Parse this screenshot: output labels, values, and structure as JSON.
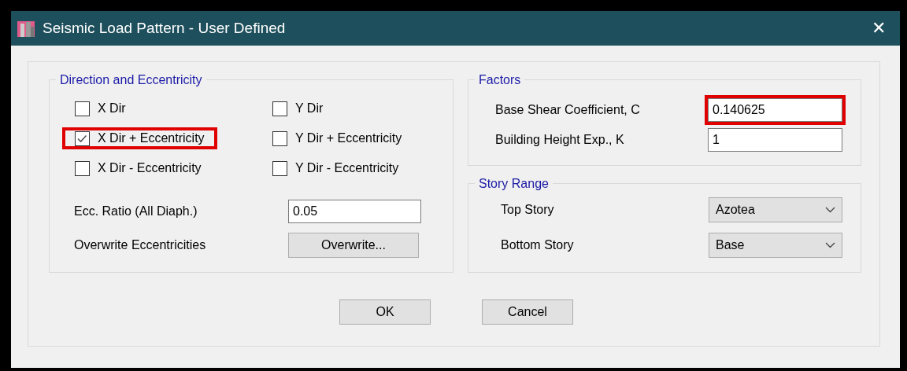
{
  "window": {
    "title": "Seismic Load Pattern - User Defined",
    "close": "✕"
  },
  "direction": {
    "title": "Direction and Eccentricity",
    "checkboxes": [
      {
        "label": "X Dir",
        "checked": false,
        "highlighted": false
      },
      {
        "label": "Y Dir",
        "checked": false,
        "highlighted": false
      },
      {
        "label": "X Dir + Eccentricity",
        "checked": true,
        "highlighted": true
      },
      {
        "label": "Y Dir + Eccentricity",
        "checked": false,
        "highlighted": false
      },
      {
        "label": "X Dir - Eccentricity",
        "checked": false,
        "highlighted": false
      },
      {
        "label": "Y Dir - Eccentricity",
        "checked": false,
        "highlighted": false
      }
    ],
    "ecc_ratio": {
      "label": "Ecc. Ratio (All Diaph.)",
      "value": "0.05"
    },
    "overwrite": {
      "label": "Overwrite Eccentricities",
      "button": "Overwrite..."
    }
  },
  "factors": {
    "title": "Factors",
    "fields": [
      {
        "label": "Base Shear Coefficient, C",
        "value": "0.140625",
        "highlighted": true
      },
      {
        "label": "Building Height Exp., K",
        "value": "1",
        "highlighted": false
      }
    ]
  },
  "story_range": {
    "title": "Story Range",
    "selects": [
      {
        "label": "Top Story",
        "value": "Azotea"
      },
      {
        "label": "Bottom Story",
        "value": "Base"
      }
    ]
  },
  "buttons": [
    "OK",
    "Cancel"
  ]
}
